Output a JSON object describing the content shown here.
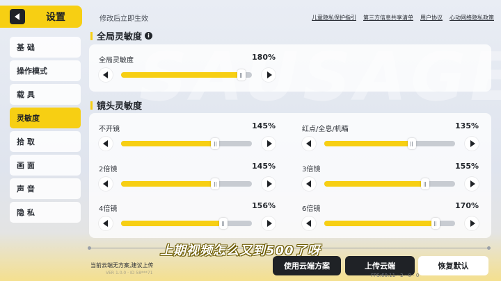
{
  "header": {
    "title": "设置"
  },
  "sidebar": {
    "items": [
      {
        "label": "基 础",
        "active": false
      },
      {
        "label": "操作模式",
        "active": false
      },
      {
        "label": "载 具",
        "active": false
      },
      {
        "label": "灵敏度",
        "active": true
      },
      {
        "label": "拾 取",
        "active": false
      },
      {
        "label": "画 面",
        "active": false
      },
      {
        "label": "声 音",
        "active": false
      },
      {
        "label": "隐 私",
        "active": false
      }
    ]
  },
  "topbar": {
    "note": "修改后立即生效",
    "links": [
      "儿童隐私保护指引",
      "第三方信息共享清单",
      "用户协议",
      "心动网络隐私政策"
    ]
  },
  "background_text": "SAUSAGE",
  "global": {
    "heading": "全局灵敏度",
    "sliders": [
      {
        "label": "全局灵敏度",
        "value_text": "180%",
        "fraction": 0.92
      }
    ]
  },
  "scope": {
    "heading": "镜头灵敏度",
    "sliders": [
      {
        "label": "不开镜",
        "value_text": "145%",
        "fraction": 0.72
      },
      {
        "label": "红点/全息/机瞄",
        "value_text": "135%",
        "fraction": 0.67
      },
      {
        "label": "2倍镜",
        "value_text": "145%",
        "fraction": 0.72
      },
      {
        "label": "3倍镜",
        "value_text": "155%",
        "fraction": 0.77
      },
      {
        "label": "4倍镜",
        "value_text": "156%",
        "fraction": 0.78
      },
      {
        "label": "6倍镜",
        "value_text": "170%",
        "fraction": 0.85
      }
    ]
  },
  "bottom": {
    "cloud_status": "当前云端无方案,建议上传",
    "use_cloud_label": "使用云端方案",
    "upload_label": "上传云端",
    "reset_label": "恢复默认",
    "fps_text": "FPS:60.11 - 2 - 0 - 0",
    "watermark": "VER 1.0.0 · ID 58***71"
  },
  "overlay_caption": "上期视频怎么又到500了呀",
  "colors": {
    "accent": "#f7cf13",
    "dark": "#1f2226",
    "track": "#c8ccd2"
  }
}
